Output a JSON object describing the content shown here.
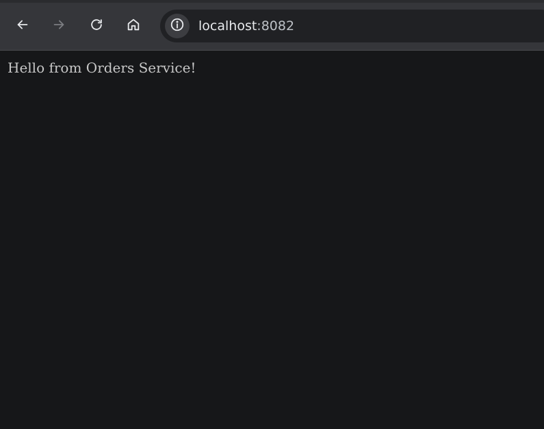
{
  "browser": {
    "toolbar": {
      "back_icon": "arrow-left-icon",
      "forward_icon": "arrow-right-icon",
      "reload_icon": "reload-icon",
      "home_icon": "home-icon",
      "forward_enabled": false
    },
    "omnibox": {
      "site_info_icon": "info-icon",
      "host": "localhost",
      "port": ":8082"
    }
  },
  "page": {
    "body_text": "Hello from Orders Service!"
  },
  "colors": {
    "toolbar_bg": "#35363a",
    "omnibox_bg": "#202124",
    "page_bg": "#161719",
    "text": "#c8c8c8"
  }
}
